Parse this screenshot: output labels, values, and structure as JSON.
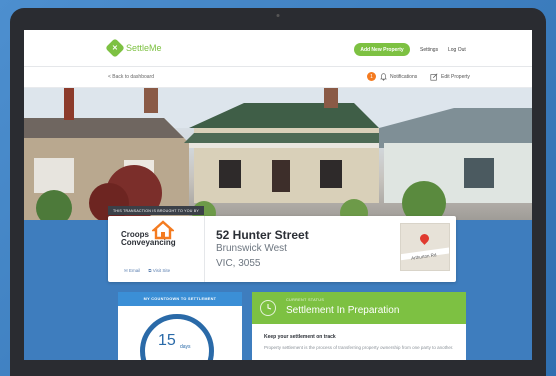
{
  "app": {
    "logo_text": "SettleMe"
  },
  "header": {
    "add_property": "Add New Property",
    "settings": "Settings",
    "logout": "Log Out"
  },
  "subheader": {
    "back": "< Back to dashboard",
    "notifications_count": "1",
    "notifications": "Notifications",
    "edit_property": "Edit Property"
  },
  "broker": {
    "tag": "THIS TRANSACTION IS BROUGHT TO YOU BY",
    "name_line1": "Croops",
    "name_line2": "Conveyancing",
    "email": "Email",
    "visit_site": "Visit Site",
    "brand_color": "#f47b20"
  },
  "property": {
    "street": "52 Hunter Street",
    "suburb": "Brunswick West",
    "state_postcode": "VIC, 3055",
    "map_street": "Arthurton Rd"
  },
  "countdown": {
    "title": "MY COUNTDOWN TO SETTLEMENT",
    "days": "15",
    "days_label": "days"
  },
  "status": {
    "small_label": "CURRENT STATUS",
    "title": "Settlement In Preparation",
    "keep_title": "Keep your settlement on track",
    "description": "Property settlement is the process of transferring property ownership from one party to another.",
    "color": "#7dc142"
  }
}
